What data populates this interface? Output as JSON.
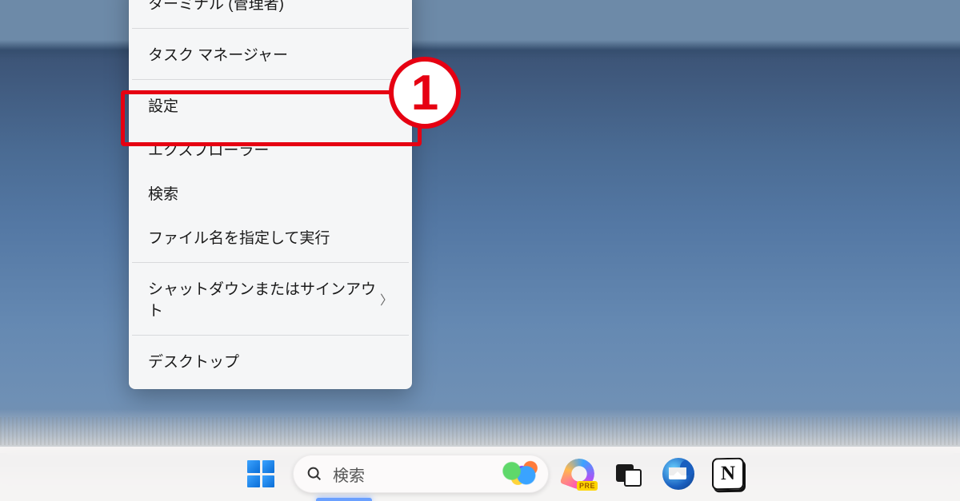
{
  "context_menu": {
    "items": [
      {
        "label": "ターミナル (管理者)",
        "has_submenu": false
      },
      {
        "separator": true
      },
      {
        "label": "タスク マネージャー",
        "has_submenu": false
      },
      {
        "separator": true
      },
      {
        "label": "設定",
        "has_submenu": false,
        "highlighted": true
      },
      {
        "label": "エクスプローラー",
        "has_submenu": false
      },
      {
        "label": "検索",
        "has_submenu": false
      },
      {
        "label": "ファイル名を指定して実行",
        "has_submenu": false
      },
      {
        "separator": true
      },
      {
        "label": "シャットダウンまたはサインアウト",
        "has_submenu": true
      },
      {
        "separator": true
      },
      {
        "label": "デスクトップ",
        "has_submenu": false
      }
    ]
  },
  "callout": {
    "number": "1"
  },
  "taskbar": {
    "search_placeholder": "検索",
    "copilot_badge": "PRE",
    "notion_glyph": "N"
  },
  "colors": {
    "highlight": "#e60012"
  }
}
